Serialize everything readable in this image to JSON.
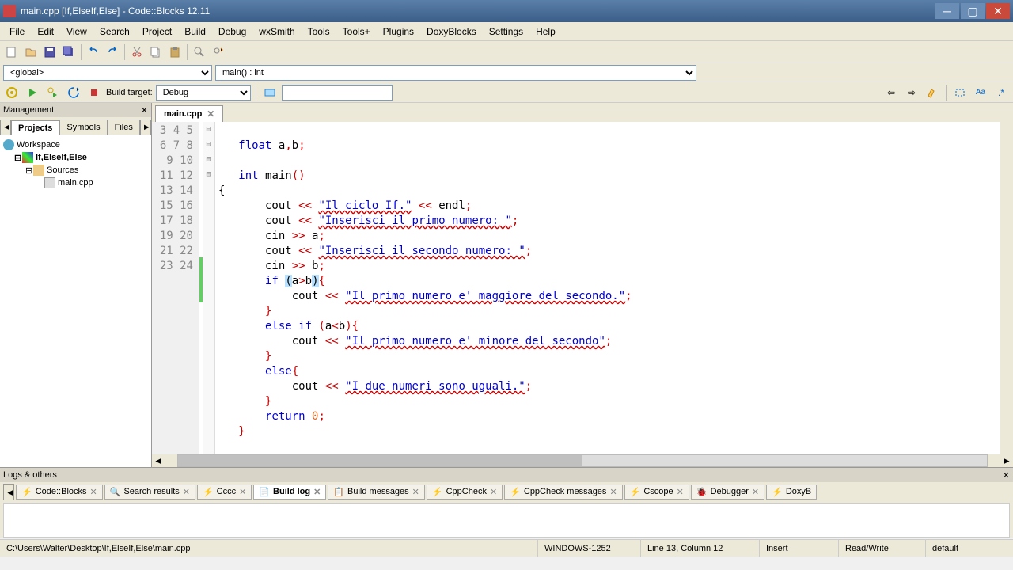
{
  "window": {
    "title": "main.cpp [If,ElseIf,Else] - Code::Blocks 12.11"
  },
  "menu": [
    "File",
    "Edit",
    "View",
    "Search",
    "Project",
    "Build",
    "Debug",
    "wxSmith",
    "Tools",
    "Tools+",
    "Plugins",
    "DoxyBlocks",
    "Settings",
    "Help"
  ],
  "scope": {
    "left": "<global>",
    "right": "main() : int"
  },
  "build": {
    "label": "Build target:",
    "value": "Debug"
  },
  "management": {
    "title": "Management",
    "tabs": [
      "Projects",
      "Symbols",
      "Files"
    ],
    "active_tab": "Projects",
    "workspace": "Workspace",
    "project": "If,ElseIf,Else",
    "sources": "Sources",
    "file": "main.cpp"
  },
  "editor": {
    "tab": "main.cpp",
    "line_start": 3,
    "line_end": 24
  },
  "logs": {
    "title": "Logs & others",
    "tabs": [
      "Code::Blocks",
      "Search results",
      "Cccc",
      "Build log",
      "Build messages",
      "CppCheck",
      "CppCheck messages",
      "Cscope",
      "Debugger",
      "DoxyB"
    ],
    "active": "Build log"
  },
  "status": {
    "path": "C:\\Users\\Walter\\Desktop\\If,ElseIf,Else\\main.cpp",
    "encoding": "WINDOWS-1252",
    "cursor": "Line 13, Column 12",
    "insert": "Insert",
    "rw": "Read/Write",
    "config": "default"
  }
}
